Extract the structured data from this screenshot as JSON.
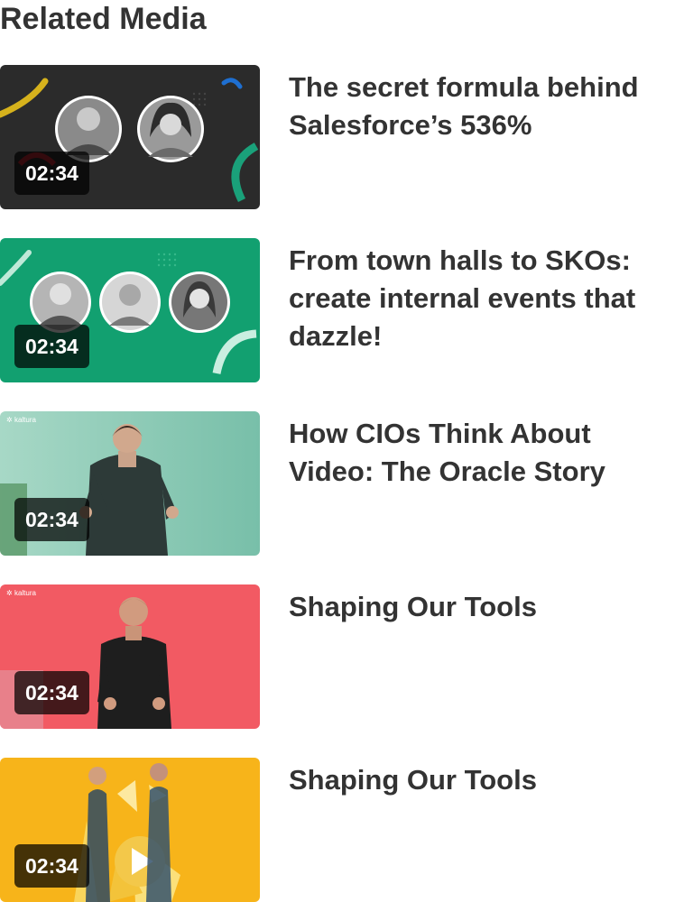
{
  "section": {
    "title": "Related Media"
  },
  "items": [
    {
      "title": "The secret formula behind Salesforce’s 536%",
      "duration": "02:34",
      "thumb_bg": "#2a2a2a"
    },
    {
      "title": "From town halls to SKOs: create internal events that dazzle!",
      "duration": "02:34",
      "thumb_bg": "#11a16f"
    },
    {
      "title": "How CIOs Think About Video: The Oracle Story",
      "duration": "02:34",
      "thumb_bg": "#8ecbb8",
      "thumb_brand": "kaltura"
    },
    {
      "title": "Shaping Our Tools",
      "duration": "02:34",
      "thumb_bg": "#f0555e",
      "thumb_brand": "kaltura"
    },
    {
      "title": "Shaping Our Tools",
      "duration": "02:34",
      "thumb_bg": "#f7b61c"
    }
  ]
}
